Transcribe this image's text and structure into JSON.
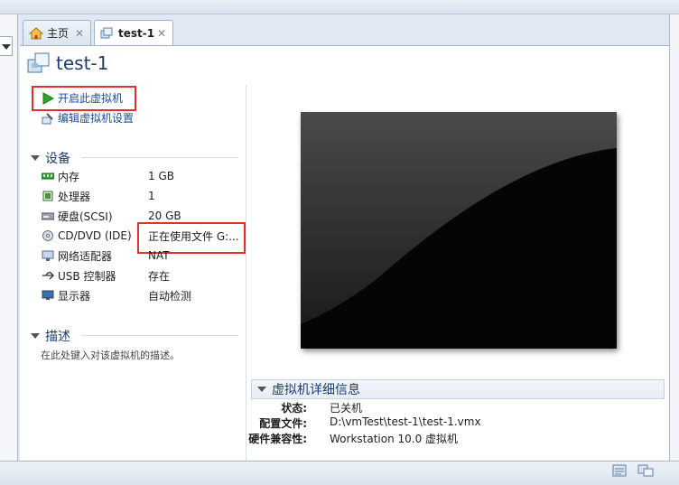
{
  "tabs": [
    {
      "label": "主页",
      "icon": "home-icon"
    },
    {
      "label": "test-1",
      "icon": "vm-icon"
    }
  ],
  "close_glyph": "✕",
  "vm": {
    "name": "test-1"
  },
  "actions": {
    "start": "开启此虚拟机",
    "edit": "编辑虚拟机设置"
  },
  "devices_section": {
    "title": "设备",
    "items": [
      {
        "name": "内存",
        "value": "1 GB",
        "icon": "memory-icon"
      },
      {
        "name": "处理器",
        "value": "1",
        "icon": "cpu-icon"
      },
      {
        "name": "硬盘(SCSI)",
        "value": "20 GB",
        "icon": "harddisk-icon"
      },
      {
        "name": "CD/DVD (IDE)",
        "value": "正在使用文件 G:...",
        "icon": "cd-icon"
      },
      {
        "name": "网络适配器",
        "value": "NAT",
        "icon": "network-icon"
      },
      {
        "name": "USB 控制器",
        "value": "存在",
        "icon": "usb-icon"
      },
      {
        "name": "显示器",
        "value": "自动检测",
        "icon": "monitor-icon"
      }
    ]
  },
  "description_section": {
    "title": "描述",
    "placeholder": "在此处键入对该虚拟机的描述。"
  },
  "details": {
    "title": "虚拟机详细信息",
    "rows": [
      {
        "key": "状态:",
        "value": "已关机"
      },
      {
        "key": "配置文件:",
        "value": "D:\\vmTest\\test-1\\test-1.vmx"
      },
      {
        "key": "硬件兼容性:",
        "value": "Workstation 10.0 虚拟机"
      }
    ]
  },
  "colors": {
    "accent": "#1c3d6e",
    "link": "#1a4f9c",
    "highlight_box": "#e03030"
  }
}
